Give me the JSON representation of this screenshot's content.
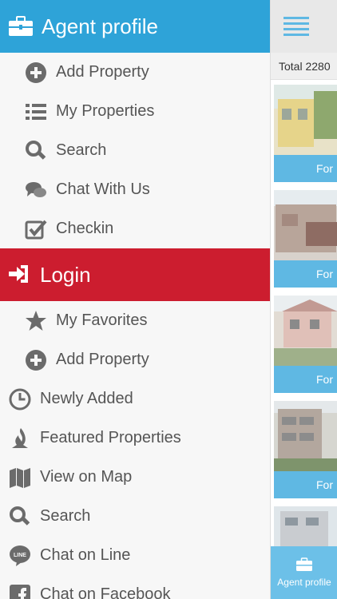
{
  "header": {
    "title": "Agent profile",
    "icon": "briefcase-icon",
    "color": "#2ea3d8"
  },
  "agent_menu": [
    {
      "label": "Add Property",
      "icon": "plus-circle-icon"
    },
    {
      "label": "My Properties",
      "icon": "list-icon"
    },
    {
      "label": "Search",
      "icon": "search-icon"
    },
    {
      "label": "Chat With Us",
      "icon": "chat-bubbles-icon"
    },
    {
      "label": "Checkin",
      "icon": "checkbox-icon"
    }
  ],
  "login": {
    "label": "Login",
    "icon": "sign-in-icon",
    "color": "#cc1d2f"
  },
  "user_menu": [
    {
      "label": "My Favorites",
      "icon": "star-icon"
    },
    {
      "label": "Add Property",
      "icon": "plus-circle-icon"
    }
  ],
  "main_menu": [
    {
      "label": "Newly Added",
      "icon": "clock-icon"
    },
    {
      "label": "Featured Properties",
      "icon": "flame-icon"
    },
    {
      "label": "View on Map",
      "icon": "map-icon"
    },
    {
      "label": "Search",
      "icon": "search-icon"
    },
    {
      "label": "Chat on Line",
      "icon": "line-icon"
    },
    {
      "label": "Chat on Facebook",
      "icon": "facebook-icon"
    }
  ],
  "content": {
    "total_label": "Total  2280",
    "cards": [
      {
        "label": "For"
      },
      {
        "label": "For"
      },
      {
        "label": "For"
      },
      {
        "label": "For"
      }
    ]
  },
  "bottom_tab": {
    "label": "Agent profile",
    "icon": "briefcase-icon"
  }
}
